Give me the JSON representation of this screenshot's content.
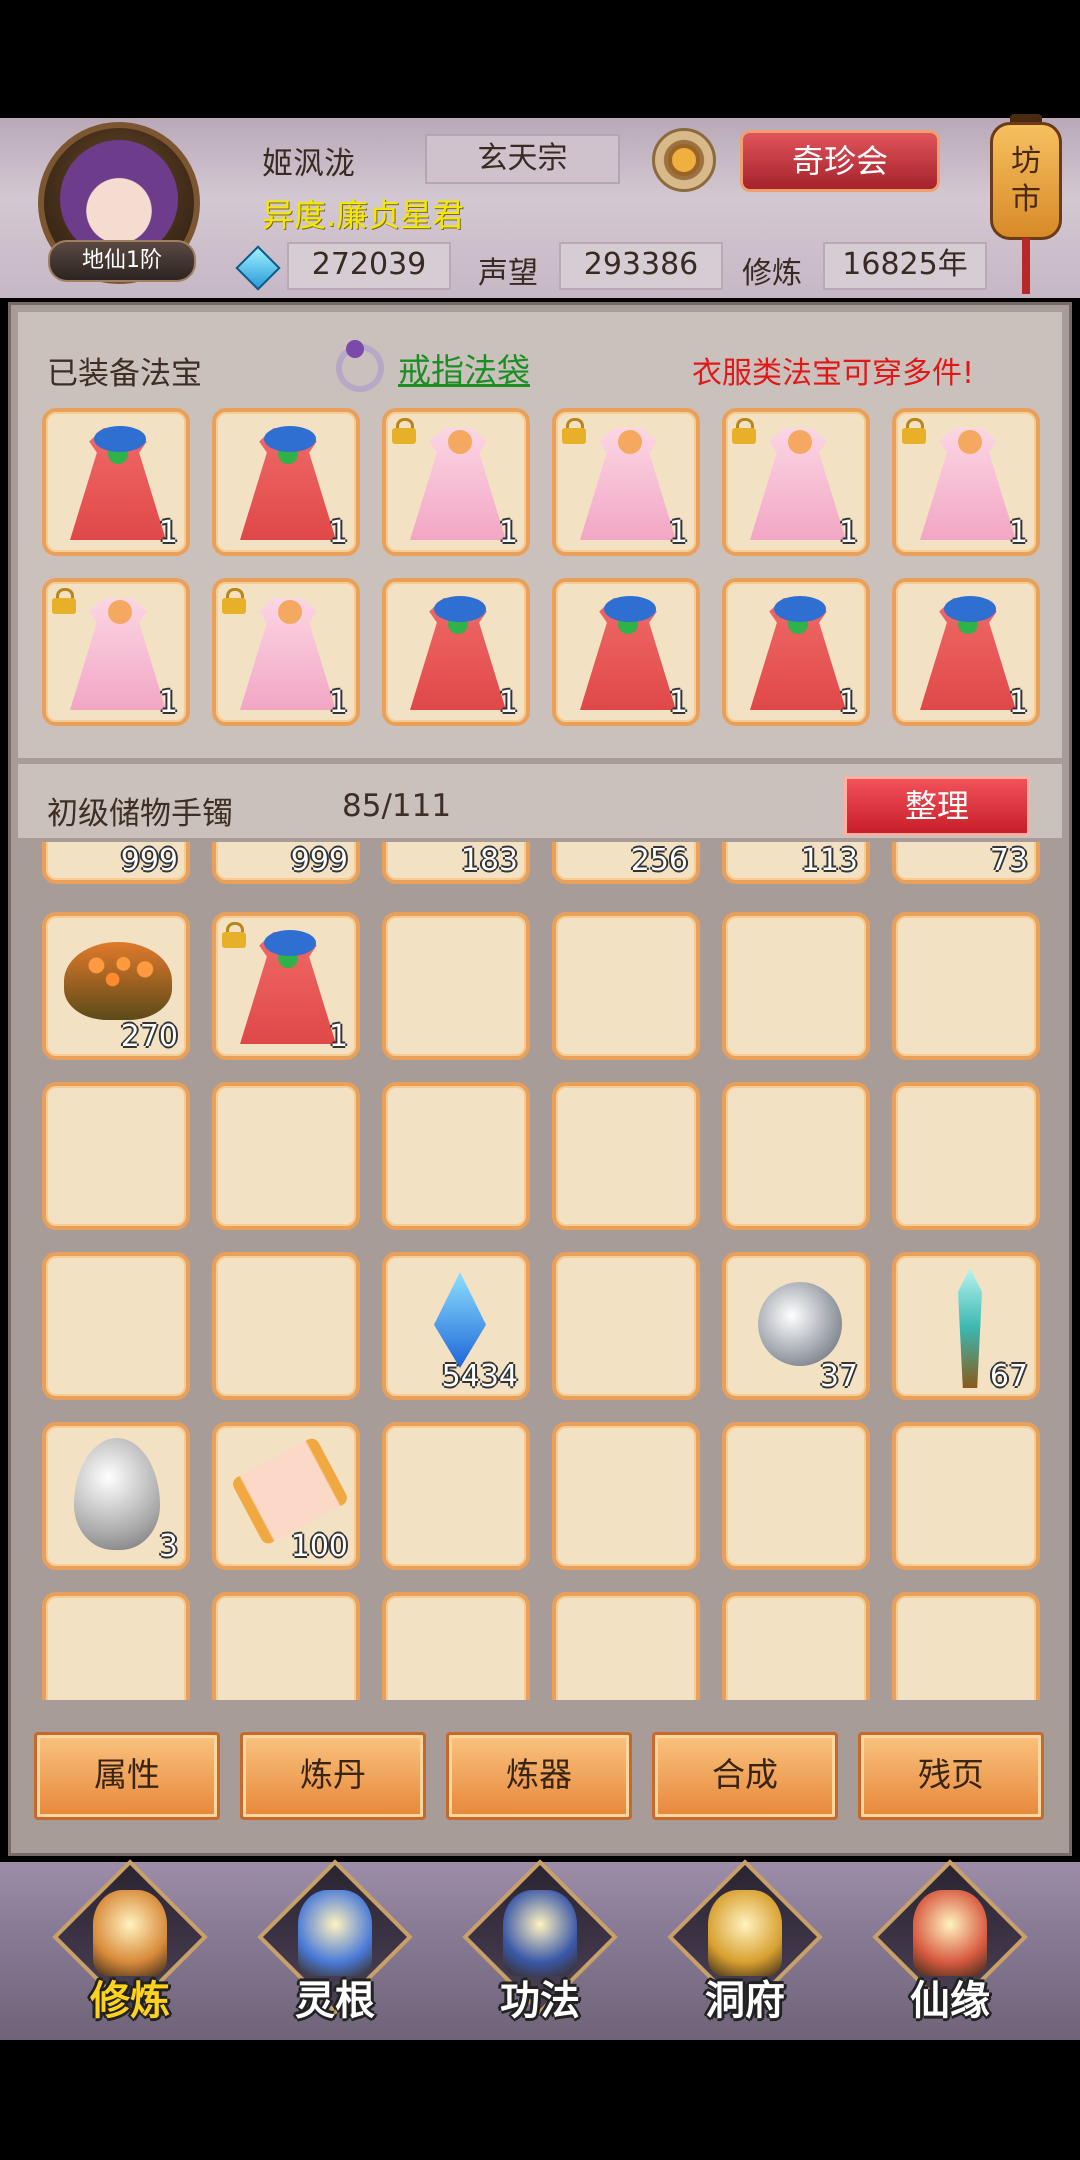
{
  "player": {
    "name": "姬沨泷",
    "sect": "玄天宗",
    "title": "异度.廉贞星君",
    "rank": "地仙1阶",
    "spirit_stones": "272039",
    "reputation_label": "声望",
    "reputation": "293386",
    "cultivation_label": "修炼",
    "cultivation": "16825年"
  },
  "header": {
    "treasure_button": "奇珍会",
    "market_lantern": "坊市"
  },
  "equipped": {
    "title": "已装备法宝",
    "ring_bag_link": "戒指法袋",
    "hint": "衣服类法宝可穿多件!",
    "slots": [
      {
        "icon": "red-robe",
        "qty": "1",
        "locked": false
      },
      {
        "icon": "red-robe",
        "qty": "1",
        "locked": false
      },
      {
        "icon": "pink-robe",
        "qty": "1",
        "locked": true
      },
      {
        "icon": "pink-robe",
        "qty": "1",
        "locked": true
      },
      {
        "icon": "pink-robe",
        "qty": "1",
        "locked": true
      },
      {
        "icon": "pink-robe",
        "qty": "1",
        "locked": true
      },
      {
        "icon": "pink-robe",
        "qty": "1",
        "locked": true
      },
      {
        "icon": "pink-robe",
        "qty": "1",
        "locked": true
      },
      {
        "icon": "red-robe",
        "qty": "1",
        "locked": false
      },
      {
        "icon": "red-robe",
        "qty": "1",
        "locked": false
      },
      {
        "icon": "red-robe",
        "qty": "1",
        "locked": false
      },
      {
        "icon": "red-robe",
        "qty": "1",
        "locked": false
      }
    ]
  },
  "bag": {
    "name": "初级储物手镯",
    "capacity": "85/111",
    "sort_button": "整理",
    "partial_row": [
      {
        "icon": "item",
        "qty": "999"
      },
      {
        "icon": "item",
        "qty": "999"
      },
      {
        "icon": "item",
        "qty": "183"
      },
      {
        "icon": "green-herb",
        "qty": "256"
      },
      {
        "icon": "blue-herb",
        "qty": "113"
      },
      {
        "icon": "red-staff",
        "qty": "73"
      }
    ],
    "rows": [
      [
        {
          "icon": "lotus-seedpod",
          "qty": "270"
        },
        {
          "icon": "red-robe",
          "qty": "1",
          "locked": true
        },
        {},
        {},
        {},
        {}
      ],
      [
        {},
        {},
        {},
        {},
        {},
        {}
      ],
      [
        {},
        {},
        {
          "icon": "blue-crystal",
          "qty": "5434"
        },
        {},
        {
          "icon": "silver-orb",
          "qty": "37"
        },
        {
          "icon": "jade-sword",
          "qty": "67"
        }
      ],
      [
        {
          "icon": "silver-egg",
          "qty": "3"
        },
        {
          "icon": "scroll",
          "qty": "100"
        },
        {},
        {},
        {},
        {}
      ],
      [
        {},
        {},
        {},
        {},
        {},
        {}
      ]
    ]
  },
  "tabs": [
    "属性",
    "炼丹",
    "炼器",
    "合成",
    "残页"
  ],
  "bottom_nav": [
    {
      "label": "修炼",
      "icon": "monk-icon",
      "active": true
    },
    {
      "label": "灵根",
      "icon": "yin-yang-sword-icon",
      "active": false
    },
    {
      "label": "功法",
      "icon": "book-icon",
      "active": false
    },
    {
      "label": "洞府",
      "icon": "pagoda-icon",
      "active": false
    },
    {
      "label": "仙缘",
      "icon": "gourd-icon",
      "active": false
    }
  ],
  "colors": {
    "hint": "#e01818",
    "link": "#1b8f24",
    "slot_border": "#e9a05a",
    "active_nav": "#ffd21e"
  }
}
